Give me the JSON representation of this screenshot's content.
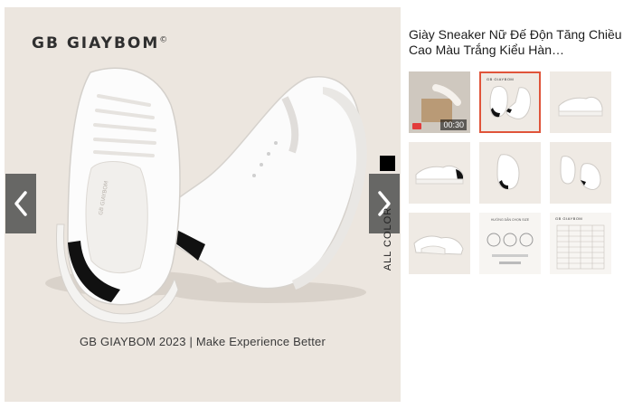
{
  "gallery": {
    "brand_logo": "GB GIAYBOM",
    "brand_mark": "©",
    "tagline": "GB GIAYBOM 2023 | Make Experience Better",
    "prev_icon": "chevron-left-icon",
    "next_icon": "chevron-right-icon",
    "all_color_label": "ALL COLOR",
    "swatch_color": "#000000"
  },
  "product": {
    "title": "Giày Sneaker Nữ Đế Độn Tăng Chiều Cao Màu Trắng Kiểu Hàn…"
  },
  "thumbnails": {
    "video_duration": "00:30",
    "selected_index": 1,
    "selected_border_color": "#e0543a",
    "mini_logo": "GB GIAYBOM",
    "guide_title": "HƯỚNG DẪN CHỌN SIZE",
    "size_table_title": "GB GIAYBOM"
  }
}
